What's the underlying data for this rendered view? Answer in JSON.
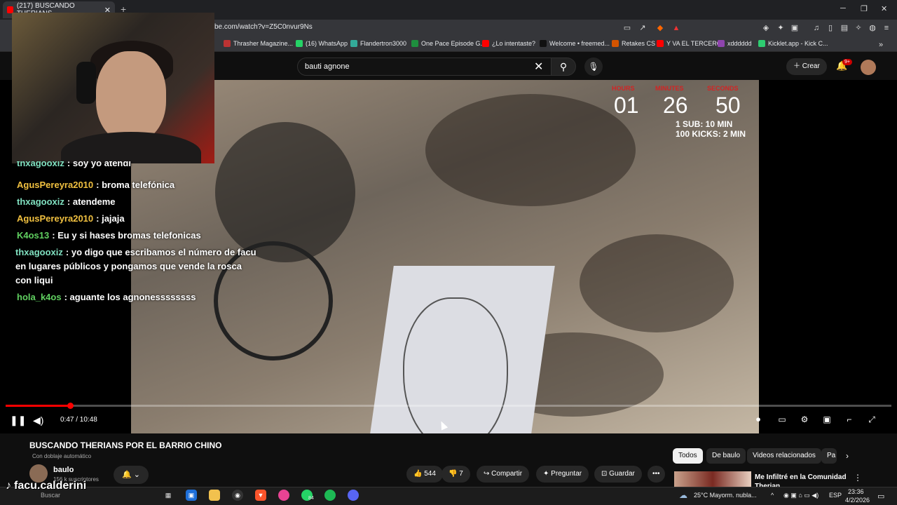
{
  "browser": {
    "tab_title": "(217) BUSCANDO THERIANS",
    "tab_close": "✕",
    "new_tab": "+",
    "url": "be.com/watch?v=Z5C0nvur9Ns",
    "window_controls": [
      "─",
      "❐",
      "✕"
    ],
    "bookmarks": [
      {
        "label": "Thrasher Magazine...",
        "color": "#b33"
      },
      {
        "label": "(16) WhatsApp",
        "color": "#25d366"
      },
      {
        "label": "Flandertron3000",
        "color": "#3a9"
      },
      {
        "label": "One Pace Episode G...",
        "color": "#1e8e3e"
      },
      {
        "label": "¿Lo intentaste?",
        "color": "#ff0000"
      },
      {
        "label": "Welcome • freemed...",
        "color": "#111"
      },
      {
        "label": "Retakes CS",
        "color": "#d35400"
      },
      {
        "label": "Y VA EL TERCERO",
        "color": "#ff0000"
      },
      {
        "label": "xdddddd",
        "color": "#8e44ad"
      },
      {
        "label": "Kicklet.app - Kick C...",
        "color": "#2ecc71"
      }
    ]
  },
  "youtube": {
    "search_value": "bauti agnone",
    "create_label": "Crear",
    "notif_badge": "9+"
  },
  "overlay": {
    "timer_labels": [
      "HOURS",
      "MINUTES",
      "SECONDS"
    ],
    "timer_values": [
      "01",
      "26",
      "50"
    ],
    "sub_info": [
      "1 SUB: 10 MIN",
      "100 KICKS: 2 MIN"
    ],
    "chat": [
      {
        "user": "thxagooxiz",
        "text": ": soy yo atendi",
        "color": "#80e0c0"
      },
      {
        "user": "AgusPereyra2010",
        "text": ": broma telefónica",
        "color": "#f0c040"
      },
      {
        "user": "thxagooxiz",
        "text": ": atendeme",
        "color": "#80e0c0"
      },
      {
        "user": "AgusPereyra2010",
        "text": ": jajaja",
        "color": "#f0c040"
      },
      {
        "user": "K4os13",
        "text": ": Eu y si hases bromas telefonicas",
        "color": "#60d060"
      },
      {
        "user": "thxagooxiz",
        "text": ": yo digo que escribamos el número de facu en lugares públicos y pongamos que vende la rosca con liqui",
        "color": "#80e0c0"
      },
      {
        "user": "hola_k4os",
        "text": ": aguante los agnonessssssss",
        "color": "#60d060"
      }
    ]
  },
  "player": {
    "time": "0:47 / 10:48",
    "progress": 0.073
  },
  "video": {
    "title": "BUSCANDO THERIANS POR EL BARRIO CHINO",
    "dubbing": "Con doblaje automático",
    "channel": "baulo",
    "subscribers": "156 k suscriptores",
    "likes": "544",
    "dislikes": "7",
    "share": "Compartir",
    "ask": "Preguntar",
    "save": "Guardar",
    "more": "•••"
  },
  "related": {
    "chips": [
      "Todos",
      "De baulo",
      "Videos relacionados",
      "Pa"
    ],
    "first_title": "Me Infiltré en la Comunidad Therian"
  },
  "watermark": "facu.calderini",
  "taskbar": {
    "search": "Buscar",
    "weather": "25°C  Mayorm. nubla...",
    "lang": "ESP",
    "time": "23:36",
    "date": "4/2/2026",
    "whatsapp_badge": "84"
  }
}
